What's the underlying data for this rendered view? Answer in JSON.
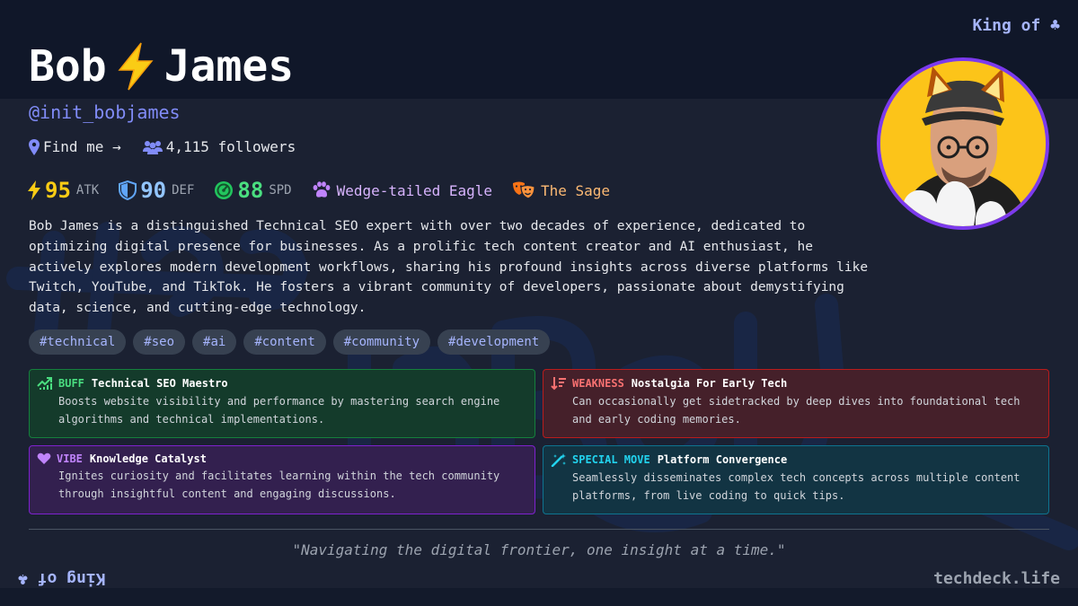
{
  "corner": {
    "top_right": "King of ♣",
    "bottom_left": "King of ♣"
  },
  "profile": {
    "name_first": "Bob",
    "name_last": "James",
    "handle": "@init_bobjames",
    "find_me": "Find me →",
    "followers": "4,115 followers"
  },
  "stats": {
    "atk": {
      "value": "95",
      "unit": "ATK"
    },
    "def": {
      "value": "90",
      "unit": "DEF"
    },
    "spd": {
      "value": "88",
      "unit": "SPD"
    },
    "spirit_animal": "Wedge-tailed Eagle",
    "archetype": "The Sage"
  },
  "bio": "Bob James is a distinguished Technical SEO expert with over two decades of experience, dedicated to optimizing digital presence for businesses. As a prolific tech content creator and AI enthusiast, he actively explores modern development workflows, sharing his profound insights across diverse platforms like Twitch, YouTube, and TikTok. He fosters a vibrant community of developers, passionate about demystifying data, science, and cutting-edge technology.",
  "tags": [
    "#technical",
    "#seo",
    "#ai",
    "#content",
    "#community",
    "#development"
  ],
  "cards": {
    "buff": {
      "kind": "BUFF",
      "title": "Technical SEO Maestro",
      "desc": "Boosts website visibility and performance by mastering search engine algorithms and technical implementations."
    },
    "weakness": {
      "kind": "WEAKNESS",
      "title": "Nostalgia For Early Tech",
      "desc": "Can occasionally get sidetracked by deep dives into foundational tech and early coding memories."
    },
    "vibe": {
      "kind": "VIBE",
      "title": "Knowledge Catalyst",
      "desc": "Ignites curiosity and facilitates learning within the tech community through insightful content and engaging discussions."
    },
    "special": {
      "kind": "SPECIAL MOVE",
      "title": "Platform Convergence",
      "desc": "Seamlessly disseminates complex tech concepts across multiple content platforms, from live coding to quick tips."
    }
  },
  "quote": "\"Navigating the digital frontier, one insight at a time.\"",
  "site": "techdeck.life",
  "colors": {
    "accent": "#818cf8",
    "atk": "#facc15",
    "def": "#93c5fd",
    "spd": "#4ade80",
    "animal": "#d8b4fe",
    "archetype": "#fdba74",
    "buff": "#4ade80",
    "weakness": "#f87171",
    "vibe": "#c084fc",
    "special": "#22d3ee",
    "avatar_ring": "#7c3aed"
  },
  "icons": {
    "name_separator": "lightning-bolt-icon",
    "find_me": "map-pin-icon",
    "followers": "users-icon",
    "atk": "lightning-icon",
    "def": "shield-icon",
    "spd": "speedometer-icon",
    "animal": "paw-icon",
    "archetype": "theater-masks-icon",
    "buff": "trending-up-icon",
    "weakness": "sort-down-icon",
    "vibe": "heart-icon",
    "special": "magic-wand-icon"
  }
}
